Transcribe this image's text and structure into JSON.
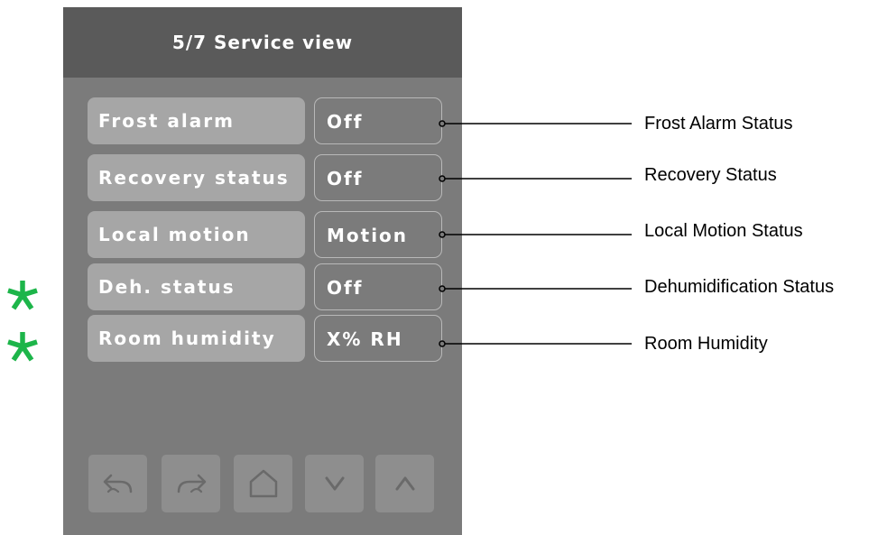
{
  "header": {
    "title": "5/7 Service view"
  },
  "rows": [
    {
      "label": "Frost alarm",
      "value": "Off",
      "callout": "Frost Alarm Status",
      "starred": false
    },
    {
      "label": "Recovery status",
      "value": "Off",
      "callout": "Recovery Status",
      "starred": false
    },
    {
      "label": "Local motion",
      "value": "Motion",
      "callout": "Local Motion Status",
      "starred": false
    },
    {
      "label": "Deh. status",
      "value": "Off",
      "callout": "Dehumidification Status",
      "starred": true
    },
    {
      "label": "Room humidity",
      "value": "X% RH",
      "callout": "Room Humidity",
      "starred": true
    }
  ],
  "nav": {
    "buttons": [
      {
        "icon": "undo-arrow-icon"
      },
      {
        "icon": "redo-arrow-icon"
      },
      {
        "icon": "home-icon"
      },
      {
        "icon": "chevron-down-icon"
      },
      {
        "icon": "chevron-up-icon"
      }
    ]
  },
  "colors": {
    "panel": "#7b7b7b",
    "header": "#5a5a5a",
    "label_bg": "#a6a6a6",
    "value_border": "#b8b8b8",
    "nav_button": "#8e8e8e",
    "icon": "#6a6a6a",
    "star": "#1db54a",
    "text": "#ffffff"
  }
}
